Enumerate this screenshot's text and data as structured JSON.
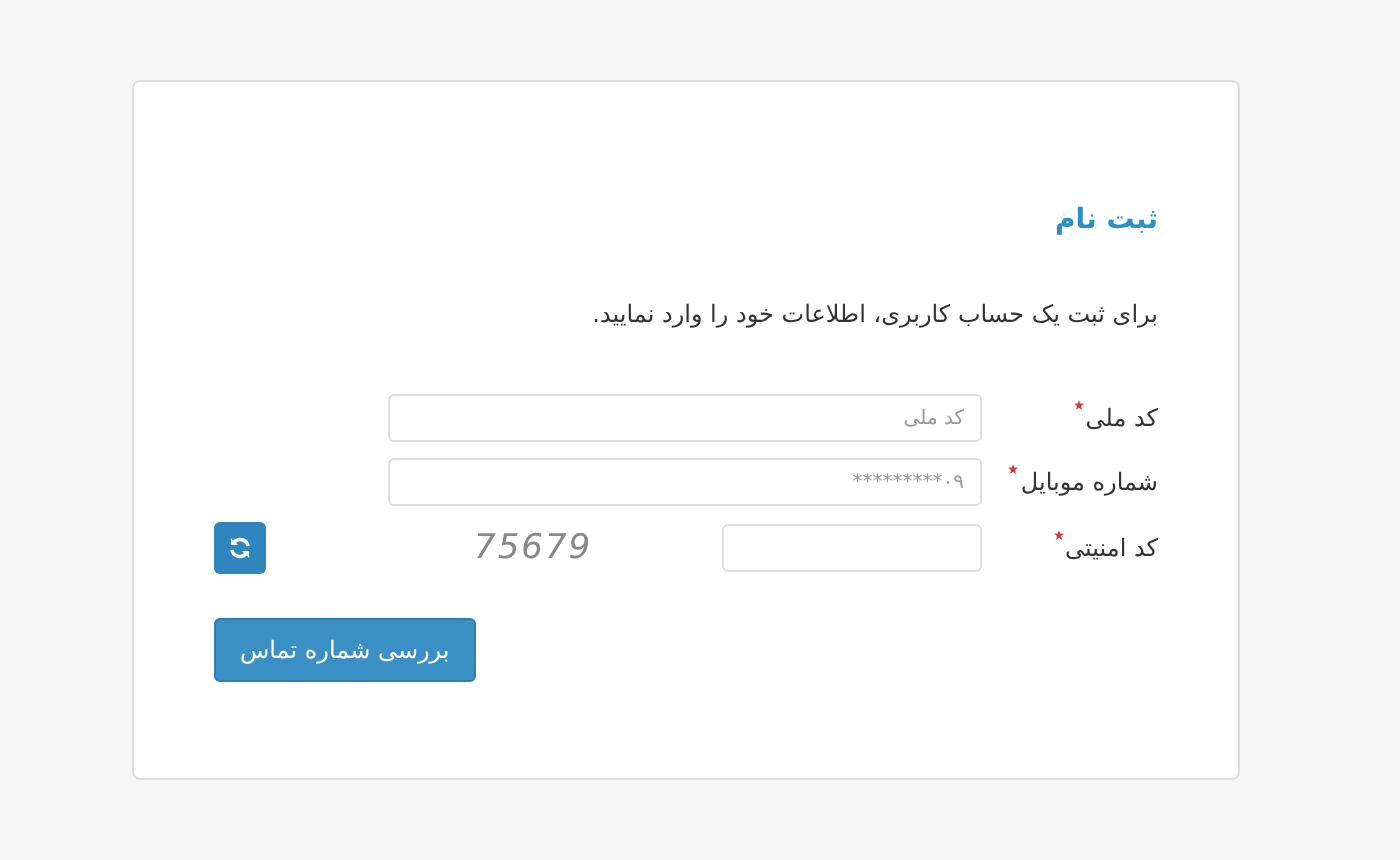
{
  "form": {
    "title": "ثبت نام",
    "intro": "برای ثبت یک حساب کاربری، اطلاعات خود را وارد نمایید.",
    "fields": [
      {
        "kind": "text",
        "label": "کد ملی",
        "required": true,
        "placeholder": "کد ملی"
      },
      {
        "kind": "text",
        "label": "شماره موبایل",
        "required": true,
        "placeholder": "۰۹*********"
      },
      {
        "kind": "captcha",
        "label": "کد امنیتی",
        "required": true,
        "captcha": "75679"
      }
    ],
    "submit": "بررسی شماره تماس"
  }
}
